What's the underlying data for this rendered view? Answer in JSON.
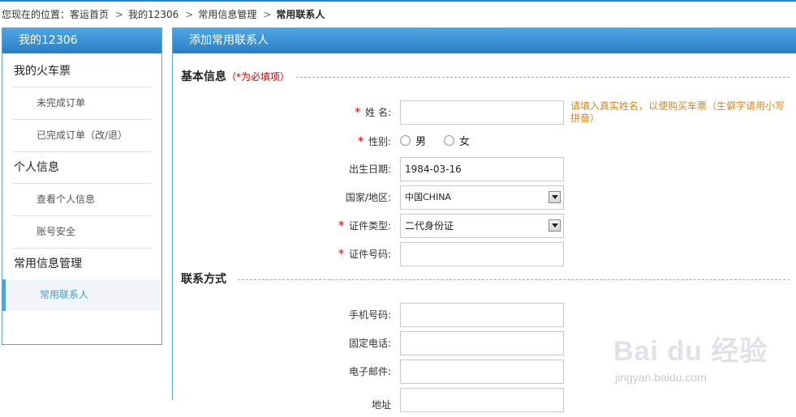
{
  "breadcrumb": {
    "prefix": "您现在的位置：",
    "items": [
      "客运首页",
      "我的12306",
      "常用信息管理"
    ],
    "current": "常用联系人",
    "separator": ">"
  },
  "sidebar": {
    "title": "我的12306",
    "groups": [
      {
        "label": "我的火车票",
        "items": [
          "未完成订单",
          "已完成订单（改/退）"
        ]
      },
      {
        "label": "个人信息",
        "items": [
          "查看个人信息",
          "账号安全"
        ]
      },
      {
        "label": "常用信息管理",
        "items": [
          "常用联系人"
        ]
      }
    ],
    "active_item": "常用联系人"
  },
  "main": {
    "title": "添加常用联系人",
    "basic_section": {
      "title": "基本信息",
      "note": "（*为必填项）"
    },
    "contact_section": {
      "title": "联系方式"
    },
    "required_mark": "*",
    "fields": {
      "name": {
        "label": "姓 名:",
        "value": "",
        "hint": "请填入真实姓名，以便购买车票（生僻字请用小写拼音）"
      },
      "gender": {
        "label": "性别:",
        "options": [
          "男",
          "女"
        ],
        "selected": null
      },
      "birth": {
        "label": "出生日期:",
        "value": "1984-03-16"
      },
      "country": {
        "label": "国家/地区:",
        "value": "中国CHINA"
      },
      "id_type": {
        "label": "证件类型:",
        "value": "二代身份证"
      },
      "id_number": {
        "label": "证件号码:",
        "value": ""
      },
      "mobile": {
        "label": "手机号码:",
        "value": ""
      },
      "phone": {
        "label": "固定电话:",
        "value": ""
      },
      "email": {
        "label": "电子邮件:",
        "value": ""
      },
      "address": {
        "label": "地址",
        "value": ""
      }
    }
  },
  "watermark": {
    "logo": "Bai du 经验",
    "url": "jingyan.baidu.com"
  },
  "colors": {
    "accent": "#2f82c2",
    "required": "#cc0000",
    "hint": "#d48a1a",
    "active_link": "#3aa0c8"
  }
}
